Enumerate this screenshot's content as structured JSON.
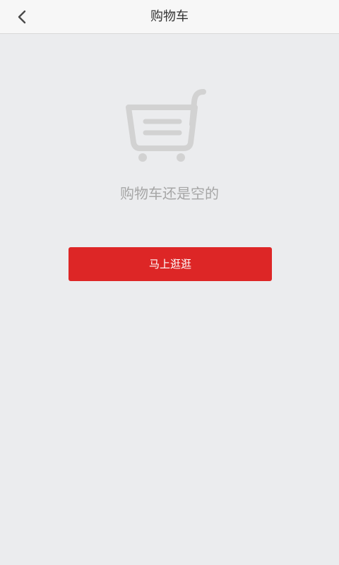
{
  "header": {
    "title": "购物车",
    "back_icon": "chevron-left-icon"
  },
  "empty_state": {
    "illustration_icon": "shopping-cart-icon",
    "message": "购物车还是空的"
  },
  "actions": {
    "go_shopping_label": "马上逛逛"
  },
  "colors": {
    "background": "#ebecee",
    "header_background": "#f7f7f7",
    "accent_red": "#dd2626",
    "muted_text": "#a6a6a6",
    "icon_gray": "#d2d2d2"
  }
}
